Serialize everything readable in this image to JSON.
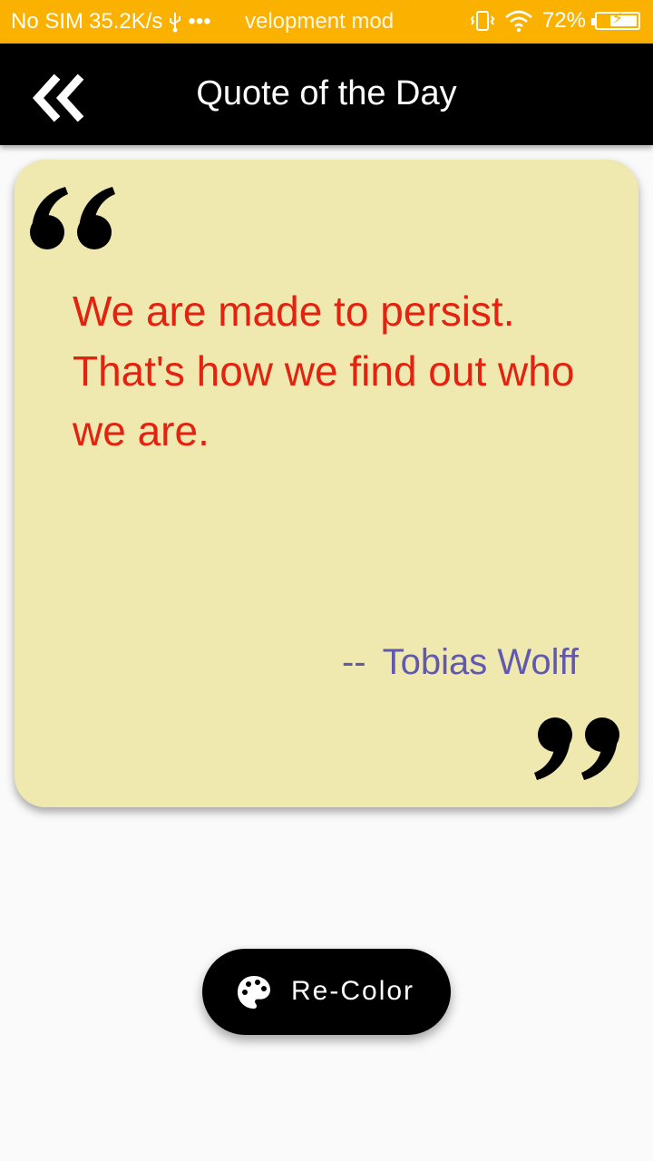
{
  "status_bar": {
    "carrier": "No SIM",
    "speed": "35.2K/s",
    "more": "•••",
    "notification": "velopment mod",
    "battery_percent": "72%",
    "battery_level": 0.72,
    "icons": [
      "usb-icon",
      "vibrate-icon",
      "wifi-icon",
      "battery-charging-icon"
    ]
  },
  "app_bar": {
    "title": "Quote of the Day",
    "back_icon": "double-chevron-left-icon"
  },
  "quote": {
    "text": "We are made to persist. That's how we find out who we are.",
    "dash": "--",
    "author": "Tobias Wolff",
    "colors": {
      "card": "#efe8af",
      "text": "#e3220f",
      "author": "#6159ad"
    }
  },
  "recolor_button": {
    "label": "Re-Color",
    "icon": "palette-icon"
  }
}
